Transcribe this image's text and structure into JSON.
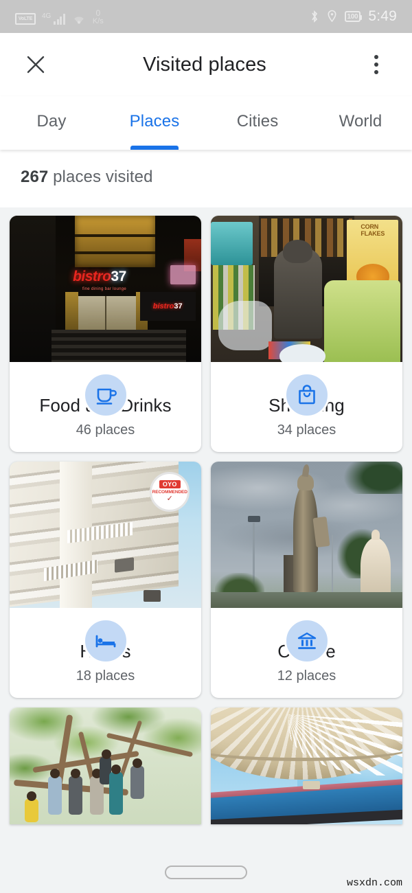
{
  "status_bar": {
    "volte_label": "VoLTE",
    "network_type": "4G",
    "signal_icon": "signal-bars-icon",
    "wifi_icon": "wifi-icon",
    "network_speed_value": "0",
    "network_speed_unit": "K/s",
    "bluetooth_icon": "bluetooth-icon",
    "location_icon": "location-pin-icon",
    "battery_level": "100",
    "time": "5:49"
  },
  "app_bar": {
    "close_icon": "close-icon",
    "title": "Visited places",
    "overflow_icon": "more-vert-icon"
  },
  "tabs": {
    "active_index": 1,
    "active_color": "#1a73e8",
    "items": [
      {
        "label": "Day"
      },
      {
        "label": "Places"
      },
      {
        "label": "Cities"
      },
      {
        "label": "World"
      }
    ]
  },
  "summary": {
    "count": "267",
    "text": " places visited"
  },
  "categories": [
    {
      "title": "Food and Drinks",
      "count_label": "46 places",
      "icon": "coffee-cup-icon",
      "photo_alt": "bistro 37 restaurant storefront at night",
      "photo_sign_main": "bistro",
      "photo_sign_accent": "37",
      "photo_sign_sub": "fine dining bar lounge"
    },
    {
      "title": "Shopping",
      "count_label": "34 places",
      "icon": "shopping-bag-icon",
      "photo_alt": "small grocery store interior with packaged goods",
      "photo_product_label": "CORN FLAKES"
    },
    {
      "title": "Hotels",
      "count_label": "18 places",
      "icon": "hotel-bed-icon",
      "photo_alt": "white multi-storey hotel building with balconies",
      "photo_badge_brand": "OYO",
      "photo_badge_text": "RECOMMENDED"
    },
    {
      "title": "Culture",
      "count_label": "12 places",
      "icon": "museum-icon",
      "photo_alt": "tall statue against cloudy sky with temple dome"
    }
  ],
  "partial_row": [
    {
      "photo_alt": "group of people climbing a large tree"
    },
    {
      "photo_alt": "stadium roof canopy against blue sky"
    }
  ],
  "nav_bar": {
    "home_indicator": "home-indicator-pill"
  },
  "watermark": "wsxdn.com"
}
